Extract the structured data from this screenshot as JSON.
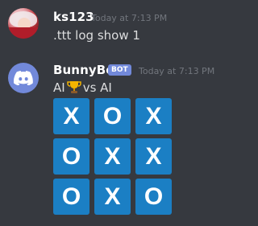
{
  "messages": [
    {
      "author": "ks123",
      "timestamp": "Today at 7:13 PM",
      "text": ".ttt log show 1"
    },
    {
      "author": "BunnyBot",
      "bot_tag": "BOT",
      "timestamp": "Today at 7:13 PM",
      "text_left": "AI",
      "icon": "trophy-icon",
      "text_right": "vs AI"
    }
  ],
  "board": [
    [
      "X",
      "O",
      "X"
    ],
    [
      "O",
      "X",
      "X"
    ],
    [
      "O",
      "X",
      "O"
    ]
  ],
  "colors": {
    "background": "#36393f",
    "cell": "#1b7fc4",
    "bot_tag": "#7289da",
    "timestamp": "#72767d"
  }
}
